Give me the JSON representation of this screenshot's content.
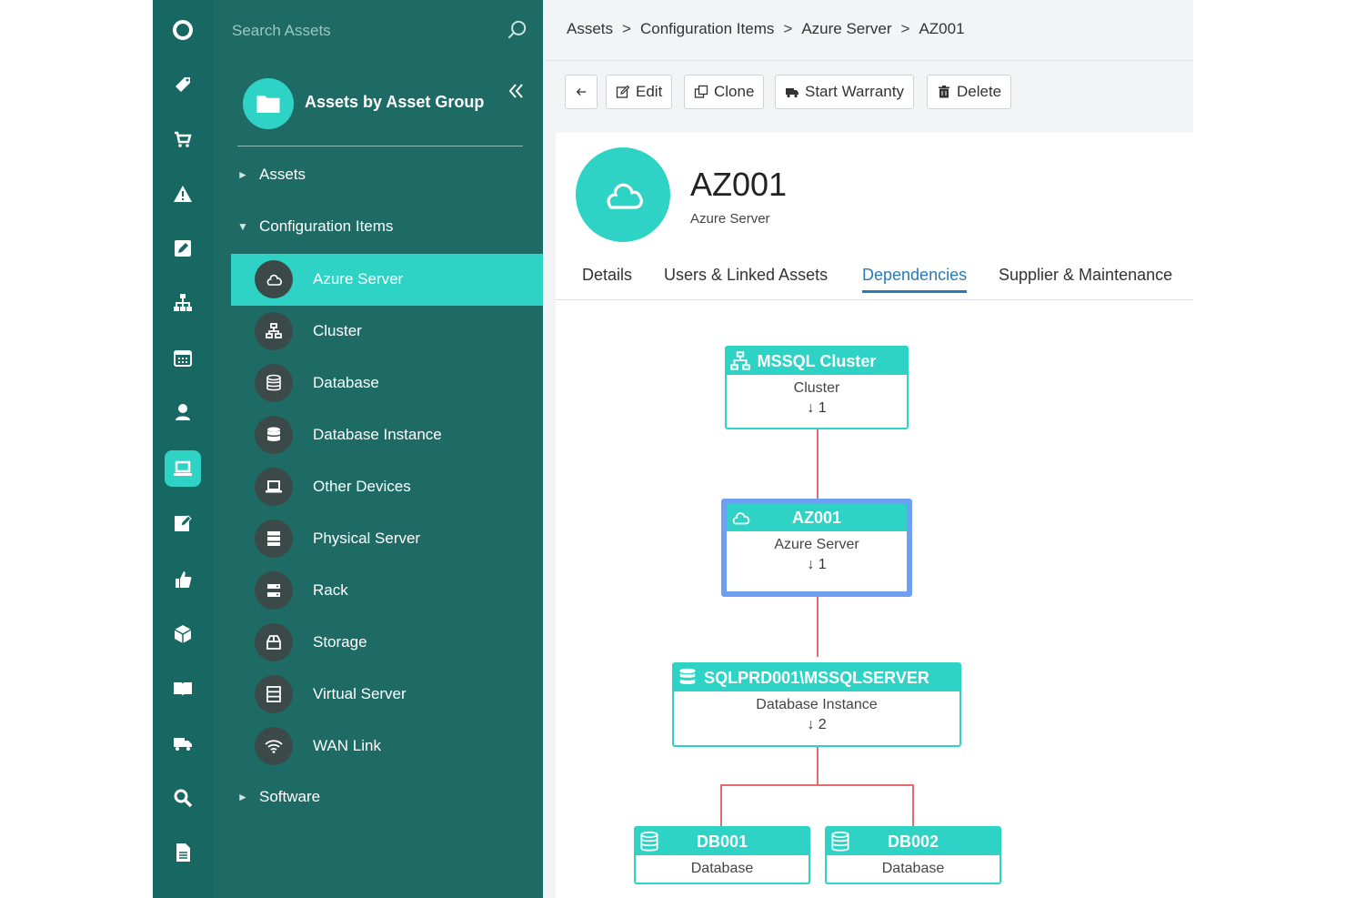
{
  "rail": {
    "icons": [
      "logo-icon",
      "tag-icon",
      "cart-icon",
      "warning-icon",
      "edit-icon",
      "hierarchy-icon",
      "calendar-icon",
      "user-icon",
      "laptop-icon",
      "notes-icon",
      "thumbs-up-icon",
      "box-icon",
      "book-icon",
      "truck-icon",
      "search-icon",
      "document-icon"
    ],
    "active": "laptop-icon"
  },
  "search": {
    "placeholder": "Search Assets"
  },
  "panel": {
    "group_title": "Assets by Asset Group",
    "tree": {
      "assets": "Assets",
      "configuration_items": "Configuration Items",
      "software": "Software"
    },
    "ci_items": [
      "Azure Server",
      "Cluster",
      "Database",
      "Database Instance",
      "Other Devices",
      "Physical Server",
      "Rack",
      "Storage",
      "Virtual Server",
      "WAN Link"
    ],
    "active_item": "Azure Server"
  },
  "breadcrumb": [
    "Assets",
    "Configuration Items",
    "Azure Server",
    "AZ001"
  ],
  "breadcrumb_sep": ">",
  "toolbar": {
    "edit": "Edit",
    "clone": "Clone",
    "start_warranty": "Start Warranty",
    "delete": "Delete"
  },
  "asset": {
    "name": "AZ001",
    "type": "Azure Server"
  },
  "tabs": [
    "Details",
    "Users & Linked Assets",
    "Dependencies",
    "Supplier & Maintenance"
  ],
  "active_tab": "Dependencies",
  "graph": {
    "cluster": {
      "name": "MSSQL Cluster",
      "type": "Cluster",
      "count": "1"
    },
    "server": {
      "name": "AZ001",
      "type": "Azure Server",
      "count": "1"
    },
    "instance": {
      "name": "SQLPRD001\\MSSQLSERVER",
      "type": "Database Instance",
      "count": "2"
    },
    "db1": {
      "name": "DB001",
      "type": "Database"
    },
    "db2": {
      "name": "DB002",
      "type": "Database"
    }
  },
  "colors": {
    "rail": "#176862",
    "panel": "#1d6b64",
    "accent": "#2ed3c6",
    "link": "#2a7ab8",
    "connector": "#e46b6b",
    "focus_border": "#6f9ff3"
  }
}
